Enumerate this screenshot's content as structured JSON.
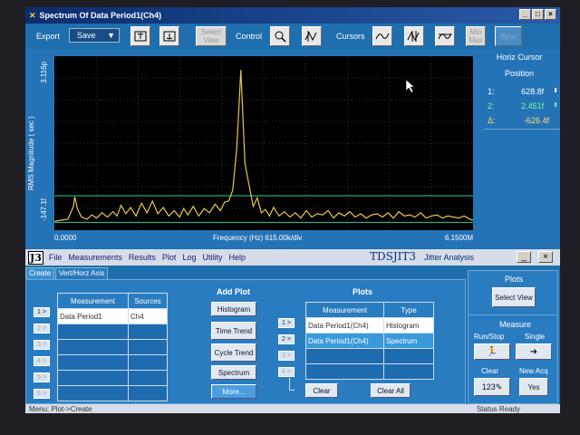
{
  "plot_window": {
    "title": "Spectrum Of Data Period1(Ch4)",
    "window_buttons": [
      "_",
      "□",
      "×"
    ]
  },
  "toolbar": {
    "export_label": "Export",
    "save_value": "Save",
    "select_view_label": "Select View",
    "control_label": "Control",
    "cursors_label": "Cursors",
    "minmax_label": "Min Max",
    "sync_label": "Sync"
  },
  "plot": {
    "ylabel": "RMS Magnitude ( sec )",
    "ymax_label": "3.116p",
    "ymin_label": "-147.1f",
    "xmin_label": "0.0000",
    "xcenter_label": "Frequency (Hz)  615.00k/div",
    "xmax_label": "6.1500M",
    "trace_color": "#e8c84a",
    "cursor_color": "#20d0a0"
  },
  "cursor_panel": {
    "title": "Horiz Cursor",
    "subtitle": "Position",
    "c1_label": "1:",
    "c1_value": "628.8f",
    "c2_label": "2:",
    "c2_value": "2.451f",
    "delta_label": "Δ:",
    "delta_value": "-626.4f"
  },
  "app": {
    "logo": "J3",
    "menu": [
      "File",
      "Measurements",
      "Results",
      "Plot",
      "Log",
      "Utility",
      "Help"
    ],
    "title": "TDSJIT3",
    "subtitle": "Jitter  Analysis",
    "window_buttons": [
      "_",
      "×"
    ]
  },
  "tabs": [
    "Create",
    "Vert/Horz Axis"
  ],
  "measurement_table": {
    "headers": [
      "Measurement",
      "Sources"
    ],
    "rows": [
      {
        "num": "1 >",
        "measurement": "Data Period1",
        "source": "Ch4"
      },
      {
        "num": "2 >",
        "measurement": "",
        "source": ""
      },
      {
        "num": "3 >",
        "measurement": "",
        "source": ""
      },
      {
        "num": "4 >",
        "measurement": "",
        "source": ""
      },
      {
        "num": "5 >",
        "measurement": "",
        "source": ""
      },
      {
        "num": "6 >",
        "measurement": "",
        "source": ""
      }
    ]
  },
  "add_plot": {
    "title": "Add Plot",
    "buttons": [
      "Histogram",
      "Time Trend",
      "Cycle Trend",
      "Spectrum",
      "More..."
    ]
  },
  "plots_table": {
    "title": "Plots",
    "headers": [
      "Measurement",
      "Type"
    ],
    "rows": [
      {
        "num": "1 >",
        "measurement": "Data Period1(Ch4)",
        "type": "Histogram"
      },
      {
        "num": "2 >",
        "measurement": "Data Period1(Ch4)",
        "type": "Spectrum"
      },
      {
        "num": "3 >",
        "measurement": "",
        "type": ""
      },
      {
        "num": "4 >",
        "measurement": "",
        "type": ""
      }
    ],
    "clear_label": "Clear",
    "clear_all_label": "Clear All"
  },
  "right_panel": {
    "plots_title": "Plots",
    "select_view_label": "Select View",
    "measure_title": "Measure",
    "run_stop_label": "Run/Stop",
    "single_label": "Single",
    "clear_label": "Clear",
    "new_acq_label": "New Acq",
    "yes_label": "Yes"
  },
  "status": {
    "left": "Menu: Plot->Create",
    "right": "Status   Ready"
  },
  "chart_data": {
    "type": "line",
    "x": [
      0.0,
      0.1,
      0.2,
      0.28,
      0.3,
      0.34,
      0.4,
      0.48,
      0.55,
      0.62,
      0.7,
      0.78,
      0.86,
      0.92,
      0.98,
      1.05,
      1.12,
      1.2,
      1.28,
      1.36,
      1.44,
      1.52,
      1.6,
      1.68,
      1.76,
      1.84,
      1.9,
      1.96,
      2.04,
      2.12,
      2.2,
      2.28,
      2.36,
      2.44,
      2.5,
      2.56,
      2.62,
      2.68,
      2.74,
      2.8,
      2.86,
      2.92,
      2.98,
      3.04,
      3.1,
      3.16,
      3.22,
      3.3,
      3.38,
      3.46,
      3.54,
      3.62,
      3.7,
      3.78,
      3.86,
      3.94,
      4.02,
      4.1,
      4.18,
      4.26,
      4.34,
      4.42,
      4.5,
      4.58,
      4.66,
      4.74,
      4.82,
      4.9,
      4.98,
      5.06,
      5.14,
      5.22,
      5.3,
      5.38,
      5.46,
      5.54,
      5.62,
      5.7,
      5.78,
      5.86,
      5.94,
      6.02,
      6.1,
      6.15
    ],
    "y": [
      0.02,
      0.04,
      0.06,
      0.3,
      0.48,
      0.25,
      0.1,
      0.06,
      0.14,
      0.08,
      0.18,
      0.1,
      0.2,
      0.12,
      0.32,
      0.16,
      0.28,
      0.12,
      0.36,
      0.18,
      0.4,
      0.16,
      0.28,
      0.12,
      0.22,
      0.1,
      0.26,
      0.14,
      0.3,
      0.12,
      0.26,
      0.18,
      0.34,
      0.22,
      0.38,
      0.4,
      0.6,
      1.4,
      2.86,
      1.1,
      0.7,
      0.3,
      0.46,
      0.18,
      0.24,
      0.12,
      0.28,
      0.12,
      0.2,
      0.1,
      0.18,
      0.08,
      0.22,
      0.1,
      0.16,
      0.14,
      0.22,
      0.08,
      0.18,
      0.12,
      0.2,
      0.1,
      0.16,
      0.08,
      0.14,
      0.16,
      0.1,
      0.18,
      0.08,
      0.2,
      0.12,
      0.14,
      0.1,
      0.18,
      0.08,
      0.12,
      0.14,
      0.08,
      0.12,
      0.1,
      0.08,
      0.12,
      0.06,
      0.04
    ],
    "xlabel": "Frequency (Hz)  615.00k/div",
    "ylabel": "RMS Magnitude ( sec )",
    "xlim": [
      0,
      6.15
    ],
    "ylim": [
      -0.147,
      3.116
    ],
    "x_unit": "MHz",
    "y_unit": "ps",
    "grid": true
  }
}
